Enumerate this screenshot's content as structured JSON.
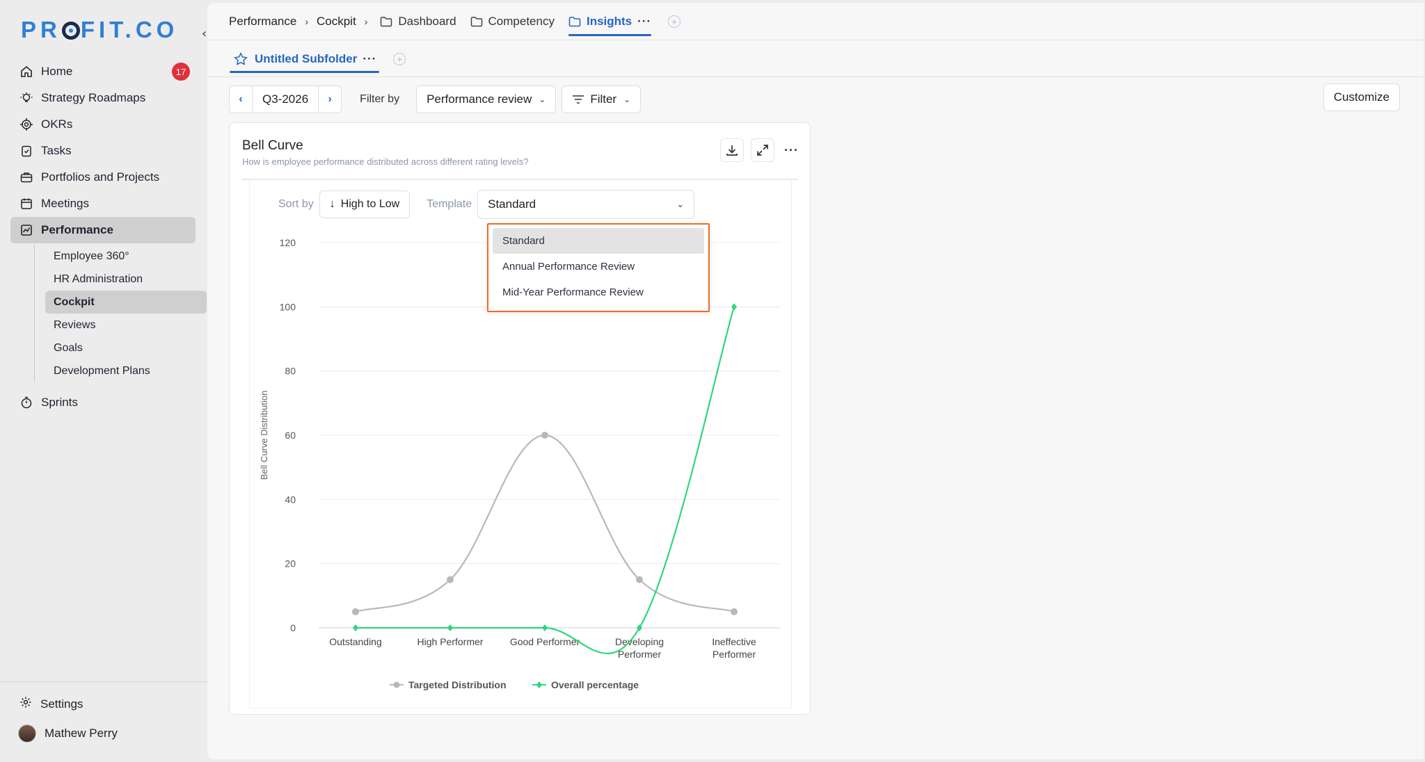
{
  "app": {
    "logo": "PROFIT.CO"
  },
  "sidebar": {
    "items": [
      {
        "label": "Home",
        "icon": "home-icon",
        "badge": "17"
      },
      {
        "label": "Strategy Roadmaps",
        "icon": "bulb-icon"
      },
      {
        "label": "OKRs",
        "icon": "target-icon"
      },
      {
        "label": "Tasks",
        "icon": "clipboard-icon"
      },
      {
        "label": "Portfolios and Projects",
        "icon": "briefcase-icon"
      },
      {
        "label": "Meetings",
        "icon": "calendar-icon"
      },
      {
        "label": "Performance",
        "icon": "chart-icon"
      }
    ],
    "performance_sub": [
      {
        "label": "Employee 360°"
      },
      {
        "label": "HR Administration"
      },
      {
        "label": "Cockpit"
      },
      {
        "label": "Reviews"
      },
      {
        "label": "Goals"
      },
      {
        "label": "Development Plans"
      }
    ],
    "sprints": "Sprints",
    "settings": "Settings",
    "user": "Mathew Perry"
  },
  "breadcrumb": {
    "items": [
      "Performance",
      "Cockpit"
    ],
    "tabs": [
      "Dashboard",
      "Competency",
      "Insights"
    ],
    "active_tab": "Insights"
  },
  "subfolder": {
    "label": "Untitled Subfolder"
  },
  "toolbar": {
    "period": "Q3-2026",
    "filter_by_label": "Filter by",
    "review_select": "Performance review",
    "filter_label": "Filter",
    "customize": "Customize"
  },
  "card": {
    "title": "Bell Curve",
    "subtitle": "How is employee performance distributed across different rating levels?",
    "sort_label": "Sort by",
    "sort_value": "High to Low",
    "template_label": "Template",
    "template_value": "Standard",
    "template_options": [
      "Standard",
      "Annual Performance Review",
      "Mid-Year Performance Review"
    ]
  },
  "chart_data": {
    "type": "line",
    "categories": [
      "Outstanding",
      "High Performer",
      "Good Performer",
      "Developing Performer",
      "Ineffective Performer"
    ],
    "series": [
      {
        "name": "Targeted Distribution",
        "values": [
          5,
          15,
          60,
          15,
          5
        ],
        "color": "#b8b8b8"
      },
      {
        "name": "Overall percentage",
        "values": [
          0,
          0,
          0,
          0,
          100
        ],
        "color": "#2fd67a"
      }
    ],
    "ylabel": "Bell Curve Distribution",
    "ylim": [
      0,
      120
    ],
    "yticks": [
      0,
      20,
      40,
      60,
      80,
      100,
      120
    ],
    "grid": true,
    "legend": "bottom"
  },
  "colors": {
    "accent": "#2566c2",
    "badge": "#e0303a",
    "dropdown_border": "#ef6a27"
  }
}
